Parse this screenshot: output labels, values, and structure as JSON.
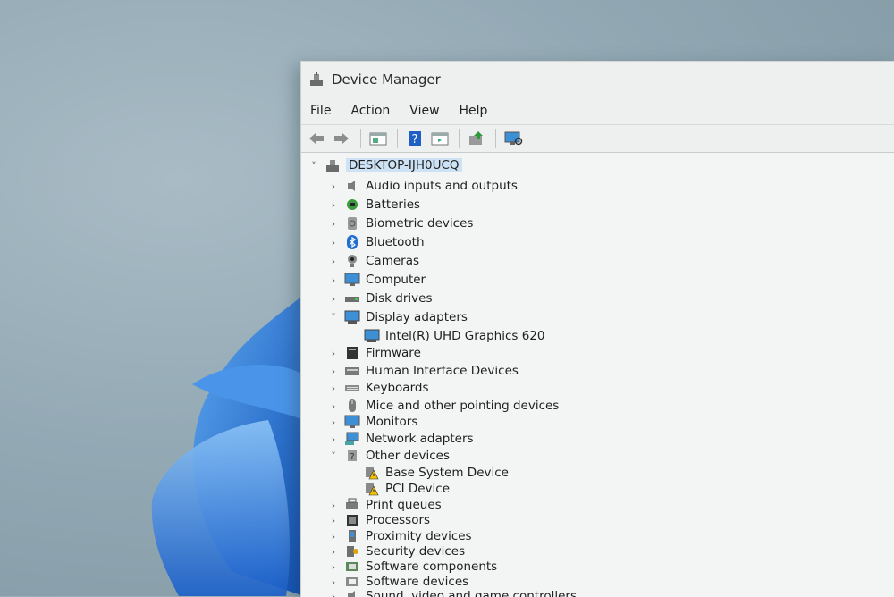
{
  "window": {
    "title": "Device Manager"
  },
  "menu": [
    "File",
    "Action",
    "View",
    "Help"
  ],
  "toolbar": {
    "buttons": [
      "back-arrow-icon",
      "forward-arrow-icon",
      "properties-icon",
      "help-icon",
      "show-hidden-icon",
      "update-driver-icon",
      "scan-hardware-icon"
    ]
  },
  "tree": {
    "root": {
      "label": "DESKTOP-IJH0UCQ",
      "icon": "computer-icon",
      "expanded": true
    },
    "nodes": [
      {
        "label": "Audio inputs and outputs",
        "icon": "speaker-icon",
        "expanded": false,
        "level": 1
      },
      {
        "label": "Batteries",
        "icon": "battery-icon",
        "expanded": false,
        "level": 1
      },
      {
        "label": "Biometric devices",
        "icon": "fingerprint-icon",
        "expanded": false,
        "level": 1
      },
      {
        "label": "Bluetooth",
        "icon": "bluetooth-icon",
        "expanded": false,
        "level": 1
      },
      {
        "label": "Cameras",
        "icon": "camera-icon",
        "expanded": false,
        "level": 1
      },
      {
        "label": "Computer",
        "icon": "monitor-icon",
        "expanded": false,
        "level": 1
      },
      {
        "label": "Disk drives",
        "icon": "disk-icon",
        "expanded": false,
        "level": 1
      },
      {
        "label": "Display adapters",
        "icon": "display-adapter-icon",
        "expanded": true,
        "level": 1
      },
      {
        "label": "Intel(R) UHD Graphics 620",
        "icon": "display-adapter-icon",
        "level": 2
      },
      {
        "label": "Firmware",
        "icon": "firmware-icon",
        "expanded": false,
        "level": 1
      },
      {
        "label": "Human Interface Devices",
        "icon": "hid-icon",
        "expanded": false,
        "level": 1
      },
      {
        "label": "Keyboards",
        "icon": "keyboard-icon",
        "expanded": false,
        "level": 1
      },
      {
        "label": "Mice and other pointing devices",
        "icon": "mouse-icon",
        "expanded": false,
        "level": 1
      },
      {
        "label": "Monitors",
        "icon": "monitor-icon",
        "expanded": false,
        "level": 1
      },
      {
        "label": "Network adapters",
        "icon": "network-icon",
        "expanded": false,
        "level": 1
      },
      {
        "label": "Other devices",
        "icon": "unknown-device-icon",
        "expanded": true,
        "level": 1
      },
      {
        "label": "Base System Device",
        "icon": "warning-device-icon",
        "level": 2
      },
      {
        "label": "PCI Device",
        "icon": "warning-device-icon",
        "level": 2
      },
      {
        "label": "Print queues",
        "icon": "printer-icon",
        "expanded": false,
        "level": 1
      },
      {
        "label": "Processors",
        "icon": "processor-icon",
        "expanded": false,
        "level": 1
      },
      {
        "label": "Proximity devices",
        "icon": "proximity-icon",
        "expanded": false,
        "level": 1
      },
      {
        "label": "Security devices",
        "icon": "security-icon",
        "expanded": false,
        "level": 1
      },
      {
        "label": "Software components",
        "icon": "software-component-icon",
        "expanded": false,
        "level": 1
      },
      {
        "label": "Software devices",
        "icon": "software-device-icon",
        "expanded": false,
        "level": 1
      },
      {
        "label": "Sound, video and game controllers",
        "icon": "sound-icon",
        "expanded": false,
        "level": 1
      }
    ]
  },
  "colors": {
    "selection": "#cde3f5",
    "wallpaper_accent": "#1f6fd1"
  }
}
